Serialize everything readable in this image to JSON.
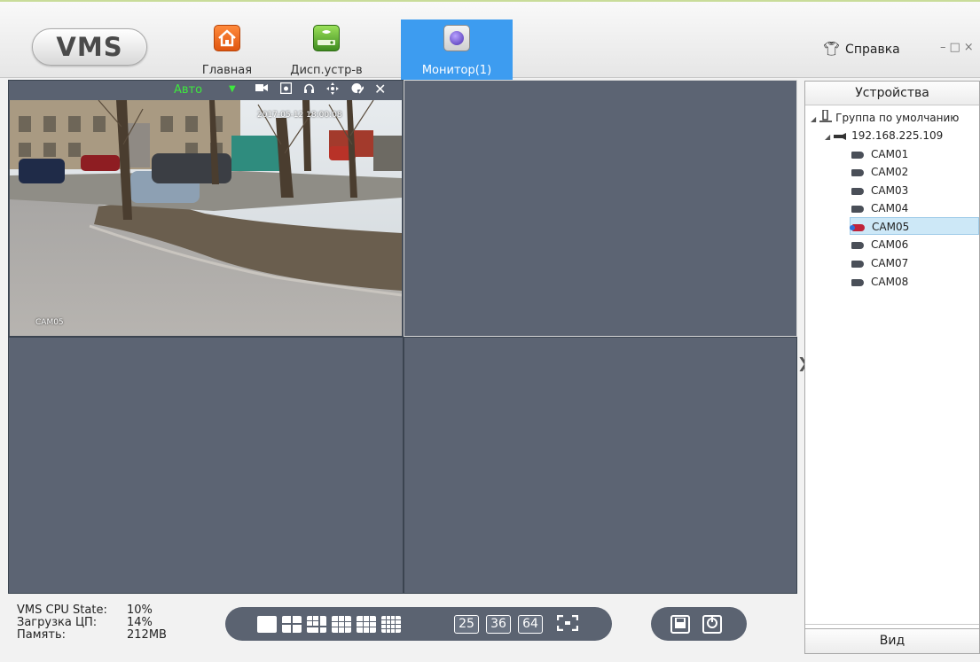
{
  "app": {
    "logo": "VMS"
  },
  "nav": {
    "tabs": [
      {
        "label": "Главная",
        "icon": "home-icon"
      },
      {
        "label": "Дисп.устр-в",
        "icon": "device-manager-icon"
      },
      {
        "label": "Монитор(1)",
        "icon": "monitor-icon",
        "active": true
      }
    ],
    "help_label": "Справка",
    "window_controls": "–□×"
  },
  "video": {
    "mode_label": "Авто",
    "toolbar_icons": [
      "record-icon",
      "snapshot-icon",
      "audio-icon",
      "ptz-icon",
      "color-adjust-icon",
      "close-icon"
    ],
    "osd_time": "2017-05-12 18:00:08",
    "osd_camera": "CAM05"
  },
  "devices": {
    "header": "Устройства",
    "group": "Группа по умолчанию",
    "device_ip": "192.168.225.109",
    "cameras": [
      "CAM01",
      "CAM02",
      "CAM03",
      "CAM04",
      "CAM05",
      "CAM06",
      "CAM07",
      "CAM08"
    ],
    "selected_camera": "CAM05",
    "view_label": "Вид"
  },
  "status": {
    "cpu_state_label": "VMS CPU State:",
    "cpu_state_value": "10%",
    "cpu_load_label": "Загрузка ЦП:",
    "cpu_load_value": "14%",
    "memory_label": "Память:",
    "memory_value": "212MB"
  },
  "layout_buttons": {
    "num25": "25",
    "num36": "36",
    "num64": "64"
  },
  "colors": {
    "active_tab": "#3d9cf0",
    "pane_bg": "#5c6473",
    "mode_label": "#3ee83e",
    "selected_row": "#cde8f7"
  }
}
